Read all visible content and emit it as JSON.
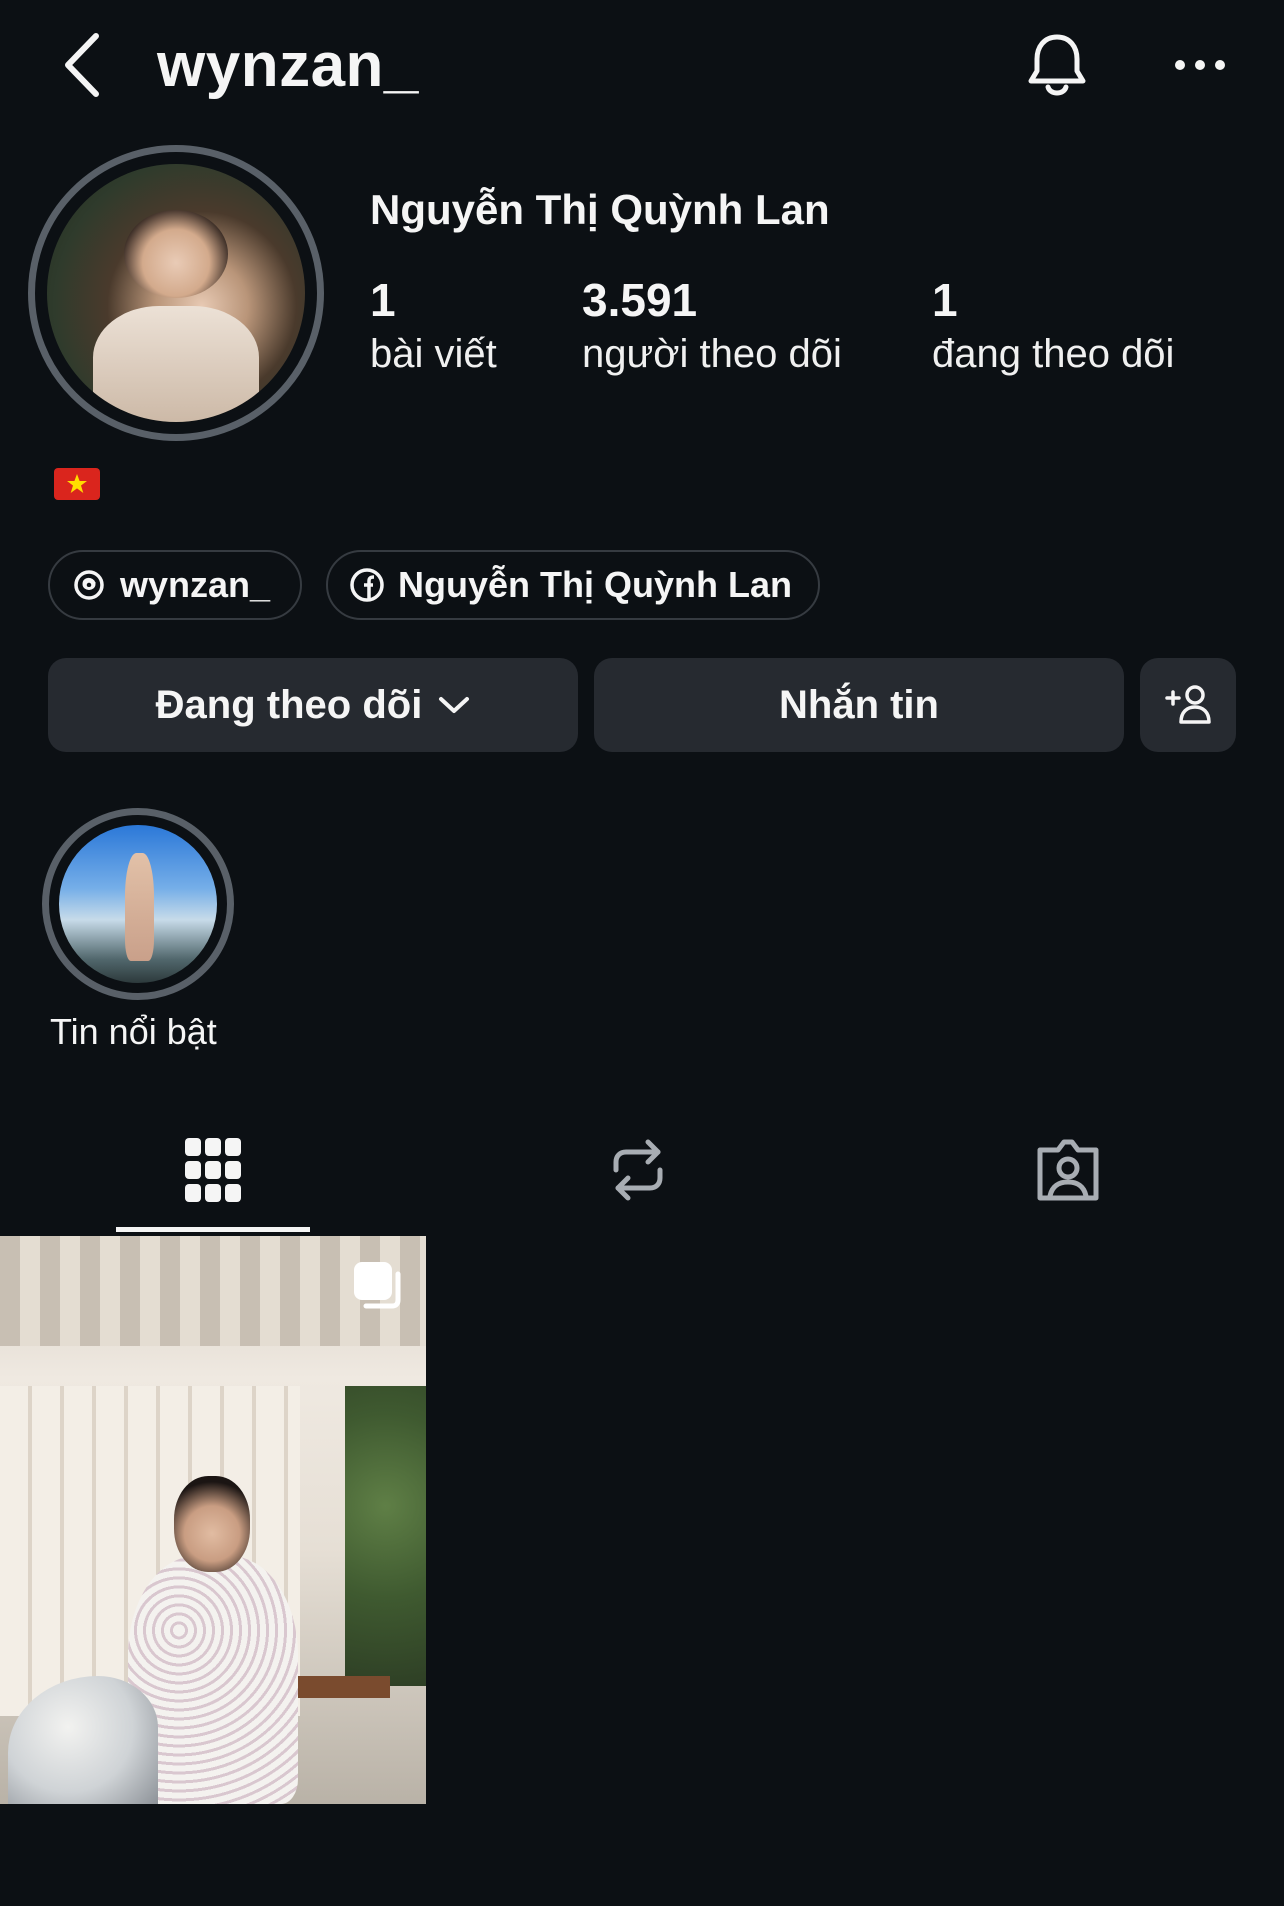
{
  "header": {
    "username": "wynzan_",
    "back_icon": "chevron-left-icon",
    "notifications_icon": "bell-icon",
    "more_icon": "more-horizontal-icon"
  },
  "profile": {
    "full_name": "Nguyễn Thị Quỳnh Lan",
    "avatar_icon": "profile-photo",
    "stats": [
      {
        "value": "1",
        "label": "bài viết"
      },
      {
        "value": "3.591",
        "label": "người theo dõi"
      },
      {
        "value": "1",
        "label": "đang theo dõi"
      }
    ],
    "bio_emoji": "vietnam-flag",
    "links": [
      {
        "icon": "threads-icon",
        "label": "wynzan_"
      },
      {
        "icon": "facebook-icon",
        "label": "Nguyễn Thị Quỳnh Lan"
      }
    ]
  },
  "actions": {
    "following_label": "Đang theo dõi",
    "message_label": "Nhắn tin",
    "suggest_icon": "add-person-icon"
  },
  "highlights": [
    {
      "label": "Tin nổi bật"
    }
  ],
  "tabs": [
    {
      "icon": "grid-icon",
      "active": true
    },
    {
      "icon": "repost-icon",
      "active": false
    },
    {
      "icon": "tagged-icon",
      "active": false
    }
  ],
  "posts": [
    {
      "type": "carousel",
      "icon": "multiple-photos-icon"
    }
  ],
  "colors": {
    "background": "#0c1014",
    "button_bg": "#262a30",
    "ring": "#596068",
    "text": "#f5f5f5"
  }
}
